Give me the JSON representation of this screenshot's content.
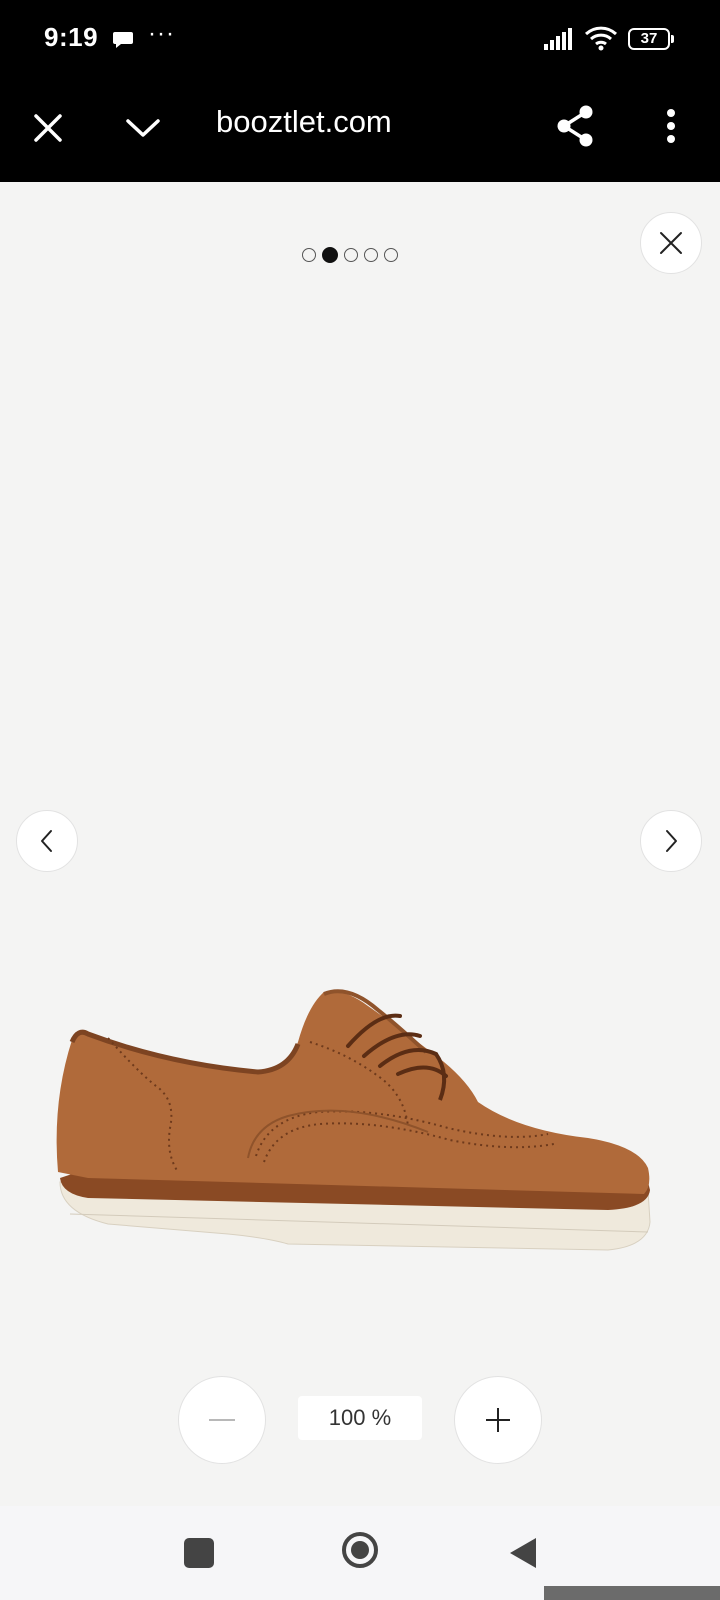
{
  "status_bar": {
    "time": "9:19",
    "more_indicator": "···",
    "battery_level": "37"
  },
  "browser": {
    "url": "booztlet.com"
  },
  "viewer": {
    "pagination": {
      "total": 5,
      "active_index": 1
    },
    "zoom_level": "100 %",
    "image_name": "brown-suede-wingtip-shoe",
    "colors": {
      "shoe": "#b06a3a",
      "sole": "#efe9dc",
      "background": "#f4f4f3"
    }
  },
  "icons": {
    "close_tab": "close-icon",
    "collapse": "chevron-down-icon",
    "share": "share-icon",
    "menu": "more-vertical-icon",
    "close_viewer": "close-icon",
    "previous": "chevron-left-icon",
    "next": "chevron-right-icon",
    "zoom_out": "minus-icon",
    "zoom_in": "plus-icon"
  }
}
